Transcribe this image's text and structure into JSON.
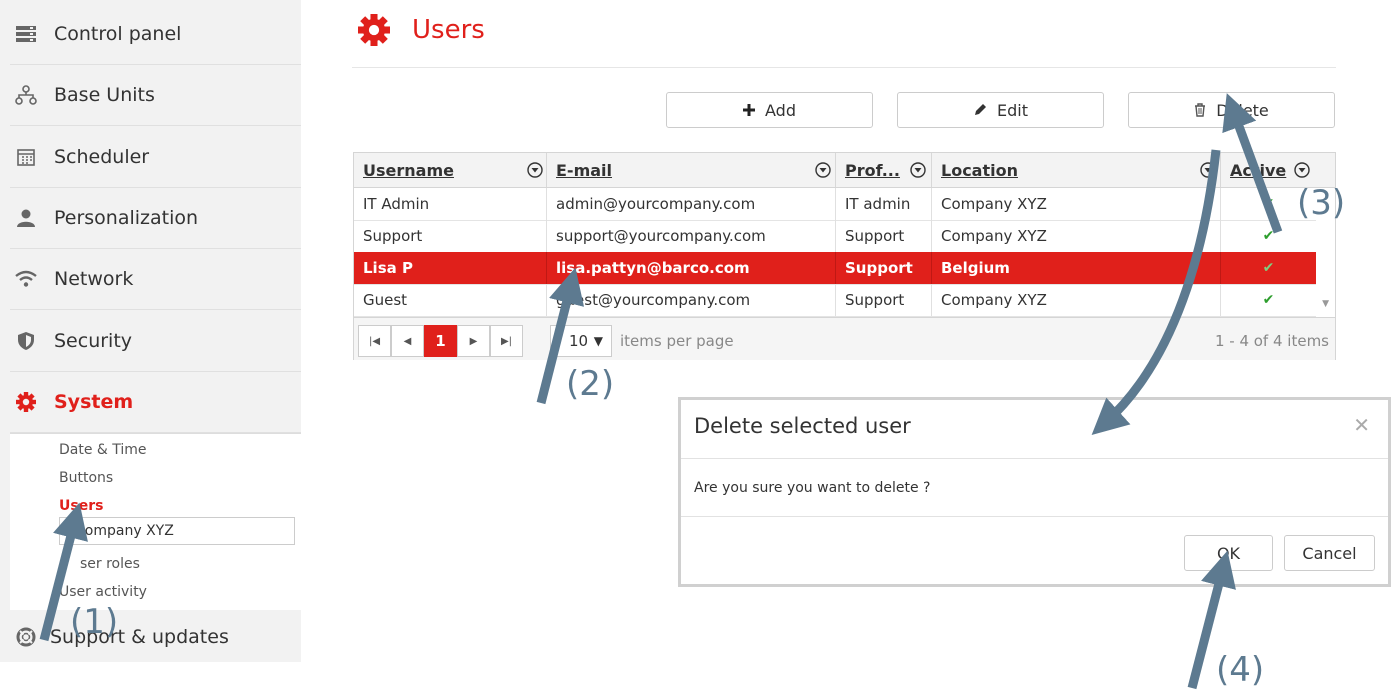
{
  "sidebar": {
    "items": [
      {
        "label": "Control panel",
        "icon": "server-icon"
      },
      {
        "label": "Base Units",
        "icon": "network-tree-icon"
      },
      {
        "label": "Scheduler",
        "icon": "calendar-icon"
      },
      {
        "label": "Personalization",
        "icon": "user-icon"
      },
      {
        "label": "Network",
        "icon": "wifi-icon"
      },
      {
        "label": "Security",
        "icon": "shield-icon"
      },
      {
        "label": "System",
        "icon": "gear-icon"
      }
    ],
    "submenu": {
      "items": [
        "Date & Time",
        "Buttons",
        "Users"
      ],
      "company_value": "Company XYZ",
      "more_items": [
        "ser roles",
        "User activity"
      ]
    },
    "support": {
      "label": "Support & updates",
      "icon": "lifebuoy-icon"
    }
  },
  "header": {
    "title": "Users",
    "icon": "gear-icon"
  },
  "toolbar": {
    "add_label": "Add",
    "edit_label": "Edit",
    "delete_label": "Delete"
  },
  "grid": {
    "columns": [
      "Username",
      "E-mail",
      "Prof...",
      "Location",
      "Active"
    ],
    "rows": [
      {
        "username": "IT Admin",
        "email": "admin@yourcompany.com",
        "profile": "IT admin",
        "location": "Company XYZ",
        "active": "✔"
      },
      {
        "username": "Support",
        "email": "support@yourcompany.com",
        "profile": "Support",
        "location": "Company XYZ",
        "active": "✔"
      },
      {
        "username": "Lisa P",
        "email": "lisa.pattyn@barco.com",
        "profile": "Support",
        "location": "Belgium",
        "active": "✔"
      },
      {
        "username": "Guest",
        "email": "guest@yourcompany.com",
        "profile": "Support",
        "location": "Company XYZ",
        "active": "✔"
      }
    ],
    "selected_row": 2,
    "pager": {
      "current_page": "1",
      "page_size": "10",
      "per_page_label": "items per page",
      "range_label": "1 - 4 of 4 items"
    }
  },
  "dialog": {
    "title": "Delete selected user",
    "message": "Are you sure you want to delete ?",
    "ok_label": "OK",
    "cancel_label": "Cancel",
    "close_symbol": "✕"
  },
  "annotations": {
    "step1": "(1)",
    "step2": "(2)",
    "step3": "(3)",
    "step4": "(4)"
  },
  "colors": {
    "accent": "#e0201b",
    "annotation": "#5d7a90",
    "check": "#2e9e2e"
  }
}
